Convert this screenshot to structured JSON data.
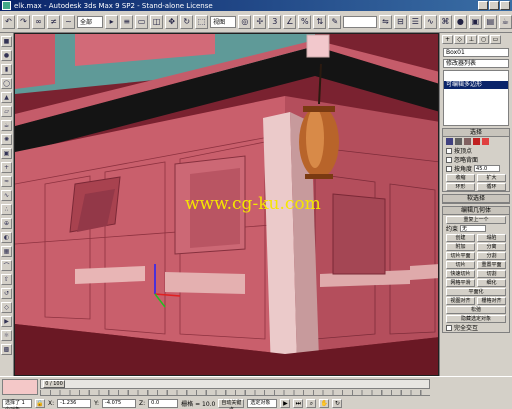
{
  "window": {
    "title": "elk.max - Autodesk 3ds Max 9 SP2 - Stand-alone License",
    "brand_color": "#0a246a"
  },
  "toolbar": {
    "selection_filter": "全部",
    "reference_coord": "视图",
    "named_selection": ""
  },
  "viewport": {
    "watermark_text": "www.cg-ku.com",
    "watermark_color": "#f5e600"
  },
  "command_panel": {
    "object_name": "Box01",
    "modifier_list_label": "修改器列表",
    "selected_modifier": "可编辑多边形",
    "rollout_selection": "选择",
    "rollout_soft": "软选择",
    "rollout_edit": "编辑几何体",
    "opt_by_vertex": "按顶点",
    "opt_ignore_back": "忽略背面",
    "opt_by_angle": "按角度",
    "angle_value": "45.0",
    "btn_shrink": "收缩",
    "btn_grow": "扩大",
    "btn_ring": "环形",
    "btn_loop": "循环",
    "btn_repeat": "重复上一个",
    "btn_constraint": "约束",
    "constraint_value": "无",
    "btn_create": "创建",
    "btn_collapse": "塌陷",
    "btn_attach": "附加",
    "btn_detach": "分离",
    "btn_slice_plane": "切片平面",
    "btn_split": "分割",
    "btn_slice": "切片",
    "btn_reset_plane": "重置平面",
    "btn_quickslice": "快速切片",
    "btn_cut": "切割",
    "btn_msmooth": "网格平滑",
    "btn_tessellate": "细化",
    "btn_make_planar": "平面化",
    "btn_view_align": "视图对齐",
    "btn_grid_align": "栅格对齐",
    "btn_relax": "松弛",
    "hide_sel": "隐藏选定对象",
    "full_interactivity": "完全交互"
  },
  "status": {
    "frame_counter": "0 / 100",
    "selected_text": "选择了 1 个对象",
    "prompt_text": "单击或单击并拖动以选择对象",
    "x_label": "X:",
    "x_value": "-1.236",
    "y_label": "Y:",
    "y_value": "-4.075",
    "z_label": "Z:",
    "z_value": "0.0",
    "grid_label": "栅格 = 10.0",
    "auto_key": "自动关键点",
    "set_key": "设置关键点",
    "key_filter": "选定对象",
    "key_filters_btn": "关键点过滤器..."
  }
}
